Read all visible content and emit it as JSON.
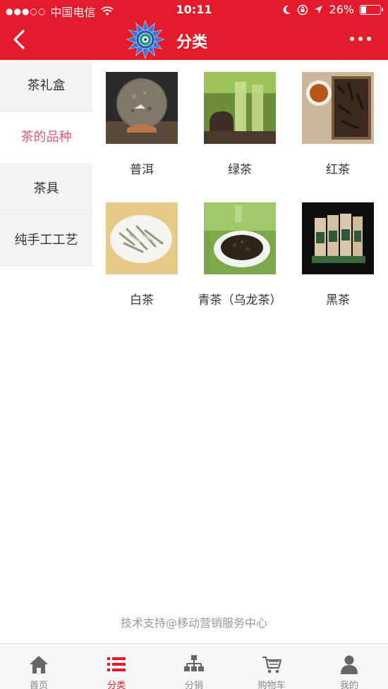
{
  "status": {
    "signal_dots": "●●●○○",
    "carrier": "中国电信",
    "time": "10:11",
    "battery_percent": "26%",
    "battery_level": 0.26
  },
  "header": {
    "title": "分类",
    "back_icon": "chevron-left-icon",
    "more_icon": "more-dots-icon"
  },
  "sidebar": {
    "items": [
      {
        "label": "茶礼盒",
        "active": false
      },
      {
        "label": "茶的品种",
        "active": true
      },
      {
        "label": "茶具",
        "active": false
      },
      {
        "label": "纯手工工艺",
        "active": false
      }
    ]
  },
  "grid": {
    "items": [
      {
        "label": "普洱"
      },
      {
        "label": "绿茶"
      },
      {
        "label": "红茶"
      },
      {
        "label": "白茶"
      },
      {
        "label": "青茶（乌龙茶）"
      },
      {
        "label": "黑茶"
      }
    ]
  },
  "footer_note": "技术支持@移动营销服务中心",
  "tabbar": {
    "items": [
      {
        "label": "首页",
        "icon": "home-icon",
        "active": false
      },
      {
        "label": "分类",
        "icon": "list-icon",
        "active": true
      },
      {
        "label": "分销",
        "icon": "org-chart-icon",
        "active": false
      },
      {
        "label": "购物车",
        "icon": "cart-icon",
        "active": false
      },
      {
        "label": "我的",
        "icon": "user-icon",
        "active": false
      }
    ]
  },
  "colors": {
    "brand_red": "#e41b2b",
    "active_pink": "#e0577c"
  }
}
